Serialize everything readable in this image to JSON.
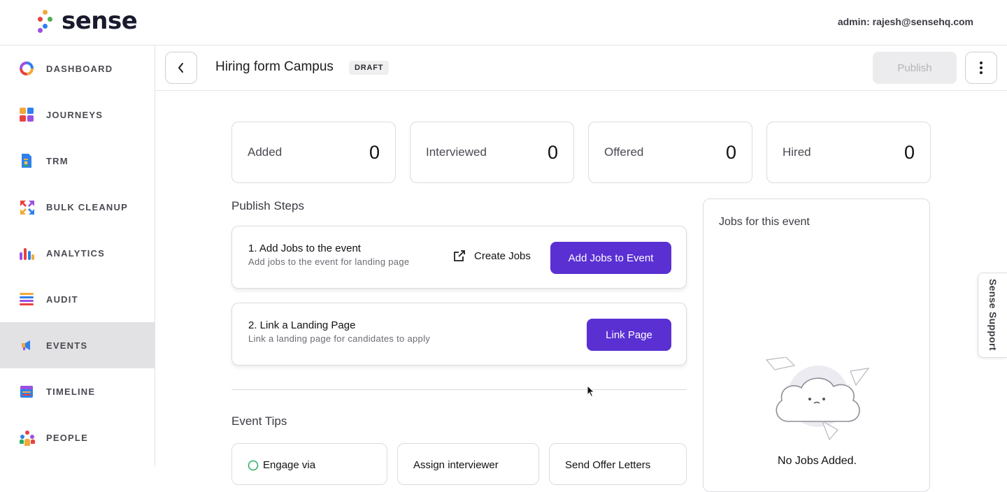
{
  "header": {
    "logo_text": "sense",
    "admin_label": "admin: rajesh@sensehq.com"
  },
  "sidebar": {
    "items": [
      {
        "label": "DASHBOARD",
        "icon": "dashboard-ring-icon",
        "active": false
      },
      {
        "label": "JOURNEYS",
        "icon": "journeys-grid-icon",
        "active": false
      },
      {
        "label": "TRM",
        "icon": "trm-document-icon",
        "active": false
      },
      {
        "label": "BULK CLEANUP",
        "icon": "bulk-cleanup-arrows-icon",
        "active": false
      },
      {
        "label": "ANALYTICS",
        "icon": "analytics-bars-icon",
        "active": false
      },
      {
        "label": "AUDIT",
        "icon": "audit-list-icon",
        "active": false
      },
      {
        "label": "EVENTS",
        "icon": "events-megaphone-icon",
        "active": true
      },
      {
        "label": "TIMELINE",
        "icon": "timeline-calendar-icon",
        "active": false
      },
      {
        "label": "PEOPLE",
        "icon": "people-group-icon",
        "active": false
      }
    ]
  },
  "page": {
    "title": "Hiring form Campus",
    "status_badge": "DRAFT",
    "publish_label": "Publish"
  },
  "stats": [
    {
      "label": "Added",
      "value": "0"
    },
    {
      "label": "Interviewed",
      "value": "0"
    },
    {
      "label": "Offered",
      "value": "0"
    },
    {
      "label": "Hired",
      "value": "0"
    }
  ],
  "publish_steps": {
    "title": "Publish Steps",
    "step1": {
      "title": "1. Add Jobs to the event",
      "subtitle": "Add jobs to the event for landing page",
      "create_label": "Create Jobs",
      "add_label": "Add Jobs to Event"
    },
    "step2": {
      "title": "2. Link a Landing Page",
      "subtitle": "Link a landing page for candidates to apply",
      "link_label": "Link Page"
    }
  },
  "event_tips": {
    "title": "Event Tips",
    "tips": [
      "Engage via",
      "Assign interviewer",
      "Send Offer Letters"
    ]
  },
  "jobs_panel": {
    "title": "Jobs for this event",
    "empty_text": "No Jobs Added."
  },
  "support_tab": "Sense Support",
  "colors": {
    "primary": "#5a30d3",
    "active_nav": "#e2e2e4"
  }
}
